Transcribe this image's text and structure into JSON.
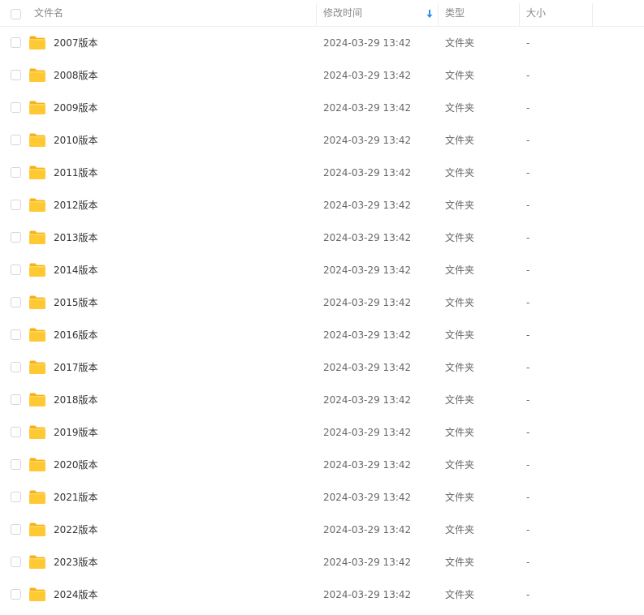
{
  "header": {
    "name_label": "文件名",
    "time_label": "修改时间",
    "type_label": "类型",
    "size_label": "大小",
    "sort_icon": "arrow-down-icon",
    "sort_color": "#2e8cf0"
  },
  "folder_icon": "folder-icon",
  "folder_color": "#ffc933",
  "rows": [
    {
      "name": "2007版本",
      "time": "2024-03-29 13:42",
      "type": "文件夹",
      "size": "-"
    },
    {
      "name": "2008版本",
      "time": "2024-03-29 13:42",
      "type": "文件夹",
      "size": "-"
    },
    {
      "name": "2009版本",
      "time": "2024-03-29 13:42",
      "type": "文件夹",
      "size": "-"
    },
    {
      "name": "2010版本",
      "time": "2024-03-29 13:42",
      "type": "文件夹",
      "size": "-"
    },
    {
      "name": "2011版本",
      "time": "2024-03-29 13:42",
      "type": "文件夹",
      "size": "-"
    },
    {
      "name": "2012版本",
      "time": "2024-03-29 13:42",
      "type": "文件夹",
      "size": "-"
    },
    {
      "name": "2013版本",
      "time": "2024-03-29 13:42",
      "type": "文件夹",
      "size": "-"
    },
    {
      "name": "2014版本",
      "time": "2024-03-29 13:42",
      "type": "文件夹",
      "size": "-"
    },
    {
      "name": "2015版本",
      "time": "2024-03-29 13:42",
      "type": "文件夹",
      "size": "-"
    },
    {
      "name": "2016版本",
      "time": "2024-03-29 13:42",
      "type": "文件夹",
      "size": "-"
    },
    {
      "name": "2017版本",
      "time": "2024-03-29 13:42",
      "type": "文件夹",
      "size": "-"
    },
    {
      "name": "2018版本",
      "time": "2024-03-29 13:42",
      "type": "文件夹",
      "size": "-"
    },
    {
      "name": "2019版本",
      "time": "2024-03-29 13:42",
      "type": "文件夹",
      "size": "-"
    },
    {
      "name": "2020版本",
      "time": "2024-03-29 13:42",
      "type": "文件夹",
      "size": "-"
    },
    {
      "name": "2021版本",
      "time": "2024-03-29 13:42",
      "type": "文件夹",
      "size": "-"
    },
    {
      "name": "2022版本",
      "time": "2024-03-29 13:42",
      "type": "文件夹",
      "size": "-"
    },
    {
      "name": "2023版本",
      "time": "2024-03-29 13:42",
      "type": "文件夹",
      "size": "-"
    },
    {
      "name": "2024版本",
      "time": "2024-03-29 13:42",
      "type": "文件夹",
      "size": "-"
    }
  ]
}
